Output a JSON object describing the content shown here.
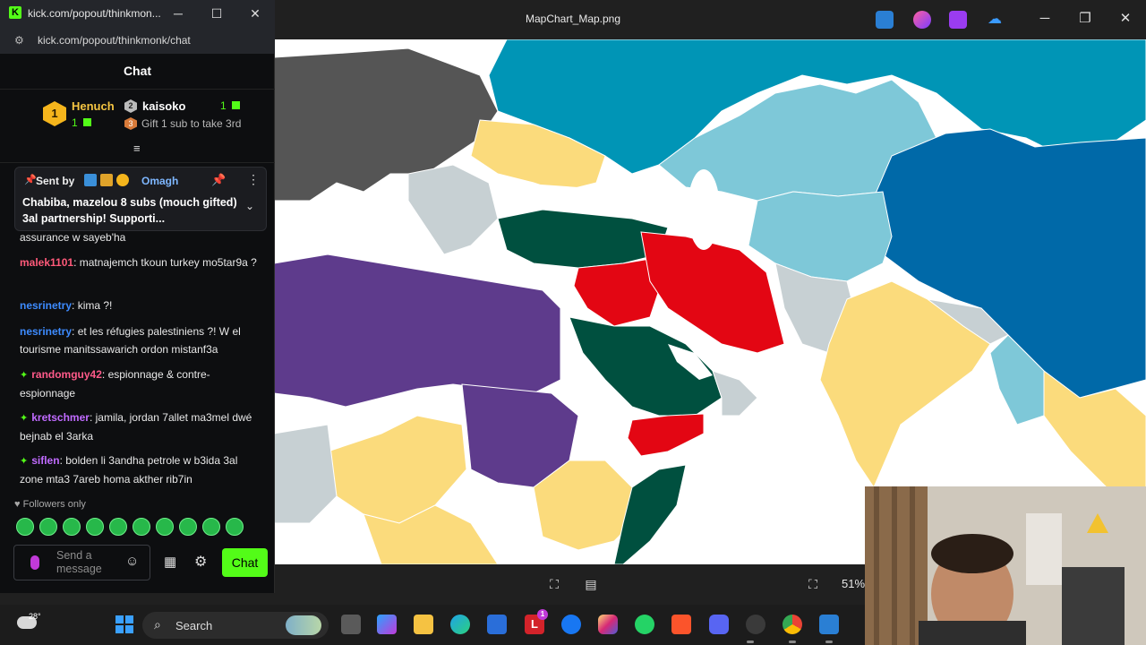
{
  "viewer": {
    "title": "MapChart_Map.png",
    "zoom": "51%"
  },
  "chat_window": {
    "title": "kick.com/popout/thinkmon...",
    "url": "kick.com/popout/thinkmonk/chat",
    "header": "Chat",
    "leaderboard": {
      "first": {
        "rank": "1",
        "name": "Henuch",
        "count": "1"
      },
      "second": {
        "rank": "2",
        "name": "kaisoko",
        "count": "1"
      },
      "third_prompt": "Gift 1 sub to take 3rd"
    },
    "pinned": {
      "sent_by": "Sent by",
      "user": "Omagh",
      "message": "Chabiba, mazelou 8 subs (mouch gifted) 3al partnership! Supporti..."
    },
    "messages": [
      {
        "user": "",
        "text": "assurance w sayeb'ha",
        "color": "#e8e8e8",
        "sub": false
      },
      {
        "user": "malek1101",
        "text": "matnajemch tkoun turkey mo5tar9a ?",
        "color": "#ff5a7a",
        "sub": false
      },
      {
        "user": "nesrinetry",
        "text": "kima ?!",
        "color": "#3d8bff",
        "sub": false
      },
      {
        "user": "nesrinetry",
        "text": "et les réfugies palestiniens ?! W el tourisme manitssawarich ordon mistanf3a",
        "color": "#3d8bff",
        "sub": false
      },
      {
        "user": "randomguy42",
        "text": "espionnage & contre-espionnage",
        "color": "#ff5a8a",
        "sub": true
      },
      {
        "user": "kretschmer",
        "text": "jamila, jordan 7allet ma3mel dwé bejnab el 3arka",
        "color": "#c06bff",
        "sub": true
      },
      {
        "user": "siflen",
        "text": "bolden li 3andha petrole w b3ida 3al zone mta3 7areb homa akther rib7in",
        "color": "#c06bff",
        "sub": true
      }
    ],
    "followers_only": "Followers only",
    "input_placeholder": "Send a message",
    "send_button": "Chat"
  },
  "taskbar": {
    "temperature": "28°",
    "search_label": "Search",
    "badge_count": "1"
  },
  "colors": {
    "kick_green": "#53fc18",
    "map_red": "#e30613",
    "map_darkgreen": "#00503f",
    "map_purple": "#5e3b8c",
    "map_yellow": "#fbdb7c",
    "map_lightblue": "#7ec8d8",
    "map_teal": "#0095b6",
    "map_darkblue": "#0069a8",
    "map_gray": "#555555",
    "map_lightgray": "#c7d0d3"
  }
}
